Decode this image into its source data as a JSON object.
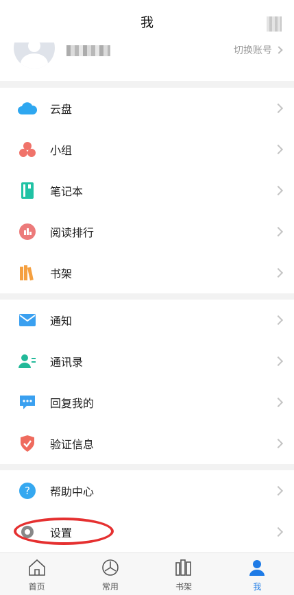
{
  "header": {
    "title": "我"
  },
  "profile": {
    "switch_label": "切换账号"
  },
  "sections": [
    {
      "items": [
        {
          "label": "云盘",
          "icon": "cloud-icon"
        },
        {
          "label": "小组",
          "icon": "group-icon"
        },
        {
          "label": "笔记本",
          "icon": "notebook-icon"
        },
        {
          "label": "阅读排行",
          "icon": "reading-rank-icon"
        },
        {
          "label": "书架",
          "icon": "bookshelf-icon"
        }
      ]
    },
    {
      "items": [
        {
          "label": "通知",
          "icon": "mail-icon"
        },
        {
          "label": "通讯录",
          "icon": "contacts-icon"
        },
        {
          "label": "回复我的",
          "icon": "chat-bubble-icon"
        },
        {
          "label": "验证信息",
          "icon": "shield-check-icon"
        }
      ]
    },
    {
      "items": [
        {
          "label": "帮助中心",
          "icon": "help-icon"
        },
        {
          "label": "设置",
          "icon": "settings-icon"
        }
      ]
    }
  ],
  "tabbar": {
    "items": [
      {
        "label": "首页",
        "icon": "home-icon",
        "active": false
      },
      {
        "label": "常用",
        "icon": "frequent-icon",
        "active": false
      },
      {
        "label": "书架",
        "icon": "bookshelf-tab-icon",
        "active": false
      },
      {
        "label": "我",
        "icon": "user-icon",
        "active": true
      }
    ]
  },
  "colors": {
    "accent": "#1e7be6",
    "annotation": "#e53030"
  }
}
